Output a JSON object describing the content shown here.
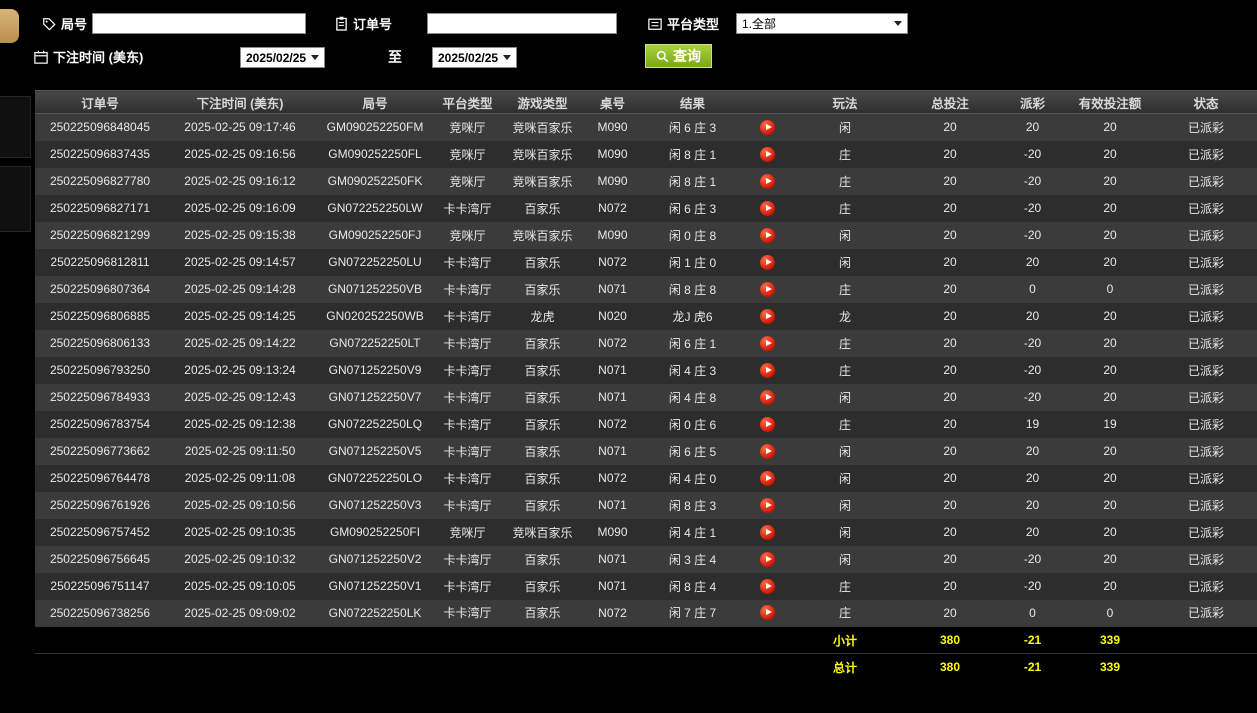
{
  "colors": {
    "payout_win_red": "#cf1d1d",
    "payout_loss_green": "#00b050",
    "status_paid_green": "#2eb82e",
    "summary_yellow": "#ffff00",
    "query_button_green": "#8cb822",
    "sidebar_tab_tan": "#c9a063"
  },
  "filters": {
    "game_no": {
      "label": "局号",
      "value": "",
      "icon": "tag-icon"
    },
    "order_no": {
      "label": "订单号",
      "value": "",
      "icon": "clipboard-icon"
    },
    "platform": {
      "label": "平台类型",
      "value": "1.全部",
      "icon": "list-icon"
    },
    "bet_time": {
      "label": "下注时间 (美东)",
      "icon": "calendar-icon"
    },
    "date_from": "2025/02/25",
    "to_label": "至",
    "date_to": "2025/02/25",
    "query_label": "查询"
  },
  "table": {
    "headers": [
      "订单号",
      "下注时间 (美东)",
      "局号",
      "平台类型",
      "游戏类型",
      "桌号",
      "结果",
      "",
      "玩法",
      "总投注",
      "派彩",
      "有效投注额",
      "状态"
    ],
    "rows": [
      {
        "order": "250225096848045",
        "time": "2025-02-25 09:17:46",
        "game": "GM090252250FM",
        "hall": "竞咪厅",
        "gtype": "竞咪百家乐",
        "tableNo": "M090",
        "result": "闲 6 庄 3",
        "method": "闲",
        "bet": "20",
        "payout": "20",
        "payout_cls": "win",
        "valid": "20",
        "status": "已派彩"
      },
      {
        "order": "250225096837435",
        "time": "2025-02-25 09:16:56",
        "game": "GM090252250FL",
        "hall": "竞咪厅",
        "gtype": "竞咪百家乐",
        "tableNo": "M090",
        "result": "闲 8 庄 1",
        "method": "庄",
        "bet": "20",
        "payout": "-20",
        "payout_cls": "loss",
        "valid": "20",
        "status": "已派彩"
      },
      {
        "order": "250225096827780",
        "time": "2025-02-25 09:16:12",
        "game": "GM090252250FK",
        "hall": "竞咪厅",
        "gtype": "竞咪百家乐",
        "tableNo": "M090",
        "result": "闲 8 庄 1",
        "method": "庄",
        "bet": "20",
        "payout": "-20",
        "payout_cls": "loss",
        "valid": "20",
        "status": "已派彩"
      },
      {
        "order": "250225096827171",
        "time": "2025-02-25 09:16:09",
        "game": "GN072252250LW",
        "hall": "卡卡湾厅",
        "gtype": "百家乐",
        "tableNo": "N072",
        "result": "闲 6 庄 3",
        "method": "庄",
        "bet": "20",
        "payout": "-20",
        "payout_cls": "loss",
        "valid": "20",
        "status": "已派彩"
      },
      {
        "order": "250225096821299",
        "time": "2025-02-25 09:15:38",
        "game": "GM090252250FJ",
        "hall": "竞咪厅",
        "gtype": "竞咪百家乐",
        "tableNo": "M090",
        "result": "闲 0 庄 8",
        "method": "闲",
        "bet": "20",
        "payout": "-20",
        "payout_cls": "loss",
        "valid": "20",
        "status": "已派彩"
      },
      {
        "order": "250225096812811",
        "time": "2025-02-25 09:14:57",
        "game": "GN072252250LU",
        "hall": "卡卡湾厅",
        "gtype": "百家乐",
        "tableNo": "N072",
        "result": "闲 1 庄 0",
        "method": "闲",
        "bet": "20",
        "payout": "20",
        "payout_cls": "win",
        "valid": "20",
        "status": "已派彩"
      },
      {
        "order": "250225096807364",
        "time": "2025-02-25 09:14:28",
        "game": "GN071252250VB",
        "hall": "卡卡湾厅",
        "gtype": "百家乐",
        "tableNo": "N071",
        "result": "闲 8 庄 8",
        "method": "庄",
        "bet": "20",
        "payout": "0",
        "payout_cls": "tie",
        "valid": "0",
        "status": "已派彩"
      },
      {
        "order": "250225096806885",
        "time": "2025-02-25 09:14:25",
        "game": "GN020252250WB",
        "hall": "卡卡湾厅",
        "gtype": "龙虎",
        "tableNo": "N020",
        "result": "龙J 虎6",
        "method": "龙",
        "bet": "20",
        "payout": "20",
        "payout_cls": "win",
        "valid": "20",
        "status": "已派彩"
      },
      {
        "order": "250225096806133",
        "time": "2025-02-25 09:14:22",
        "game": "GN072252250LT",
        "hall": "卡卡湾厅",
        "gtype": "百家乐",
        "tableNo": "N072",
        "result": "闲 6 庄 1",
        "method": "庄",
        "bet": "20",
        "payout": "-20",
        "payout_cls": "loss",
        "valid": "20",
        "status": "已派彩"
      },
      {
        "order": "250225096793250",
        "time": "2025-02-25 09:13:24",
        "game": "GN071252250V9",
        "hall": "卡卡湾厅",
        "gtype": "百家乐",
        "tableNo": "N071",
        "result": "闲 4 庄 3",
        "method": "庄",
        "bet": "20",
        "payout": "-20",
        "payout_cls": "loss",
        "valid": "20",
        "status": "已派彩"
      },
      {
        "order": "250225096784933",
        "time": "2025-02-25 09:12:43",
        "game": "GN071252250V7",
        "hall": "卡卡湾厅",
        "gtype": "百家乐",
        "tableNo": "N071",
        "result": "闲 4 庄 8",
        "method": "闲",
        "bet": "20",
        "payout": "-20",
        "payout_cls": "loss",
        "valid": "20",
        "status": "已派彩"
      },
      {
        "order": "250225096783754",
        "time": "2025-02-25 09:12:38",
        "game": "GN072252250LQ",
        "hall": "卡卡湾厅",
        "gtype": "百家乐",
        "tableNo": "N072",
        "result": "闲 0 庄 6",
        "method": "庄",
        "bet": "20",
        "payout": "19",
        "payout_cls": "win",
        "valid": "19",
        "status": "已派彩"
      },
      {
        "order": "250225096773662",
        "time": "2025-02-25 09:11:50",
        "game": "GN071252250V5",
        "hall": "卡卡湾厅",
        "gtype": "百家乐",
        "tableNo": "N071",
        "result": "闲 6 庄 5",
        "method": "闲",
        "bet": "20",
        "payout": "20",
        "payout_cls": "win",
        "valid": "20",
        "status": "已派彩"
      },
      {
        "order": "250225096764478",
        "time": "2025-02-25 09:11:08",
        "game": "GN072252250LO",
        "hall": "卡卡湾厅",
        "gtype": "百家乐",
        "tableNo": "N072",
        "result": "闲 4 庄 0",
        "method": "闲",
        "bet": "20",
        "payout": "20",
        "payout_cls": "win",
        "valid": "20",
        "status": "已派彩"
      },
      {
        "order": "250225096761926",
        "time": "2025-02-25 09:10:56",
        "game": "GN071252250V3",
        "hall": "卡卡湾厅",
        "gtype": "百家乐",
        "tableNo": "N071",
        "result": "闲 8 庄 3",
        "method": "闲",
        "bet": "20",
        "payout": "20",
        "payout_cls": "win",
        "valid": "20",
        "status": "已派彩"
      },
      {
        "order": "250225096757452",
        "time": "2025-02-25 09:10:35",
        "game": "GM090252250FI",
        "hall": "竞咪厅",
        "gtype": "竞咪百家乐",
        "tableNo": "M090",
        "result": "闲 4 庄 1",
        "method": "闲",
        "bet": "20",
        "payout": "20",
        "payout_cls": "win",
        "valid": "20",
        "status": "已派彩"
      },
      {
        "order": "250225096756645",
        "time": "2025-02-25 09:10:32",
        "game": "GN071252250V2",
        "hall": "卡卡湾厅",
        "gtype": "百家乐",
        "tableNo": "N071",
        "result": "闲 3 庄 4",
        "method": "闲",
        "bet": "20",
        "payout": "-20",
        "payout_cls": "loss",
        "valid": "20",
        "status": "已派彩"
      },
      {
        "order": "250225096751147",
        "time": "2025-02-25 09:10:05",
        "game": "GN071252250V1",
        "hall": "卡卡湾厅",
        "gtype": "百家乐",
        "tableNo": "N071",
        "result": "闲 8 庄 4",
        "method": "庄",
        "bet": "20",
        "payout": "-20",
        "payout_cls": "loss",
        "valid": "20",
        "status": "已派彩"
      },
      {
        "order": "250225096738256",
        "time": "2025-02-25 09:09:02",
        "game": "GN072252250LK",
        "hall": "卡卡湾厅",
        "gtype": "百家乐",
        "tableNo": "N072",
        "result": "闲 7 庄 7",
        "method": "庄",
        "bet": "20",
        "payout": "0",
        "payout_cls": "tie",
        "valid": "0",
        "status": "已派彩"
      }
    ],
    "subtotal": {
      "label": "小计",
      "bet": "380",
      "payout": "-21",
      "valid": "339"
    },
    "total": {
      "label": "总计",
      "bet": "380",
      "payout": "-21",
      "valid": "339"
    }
  }
}
